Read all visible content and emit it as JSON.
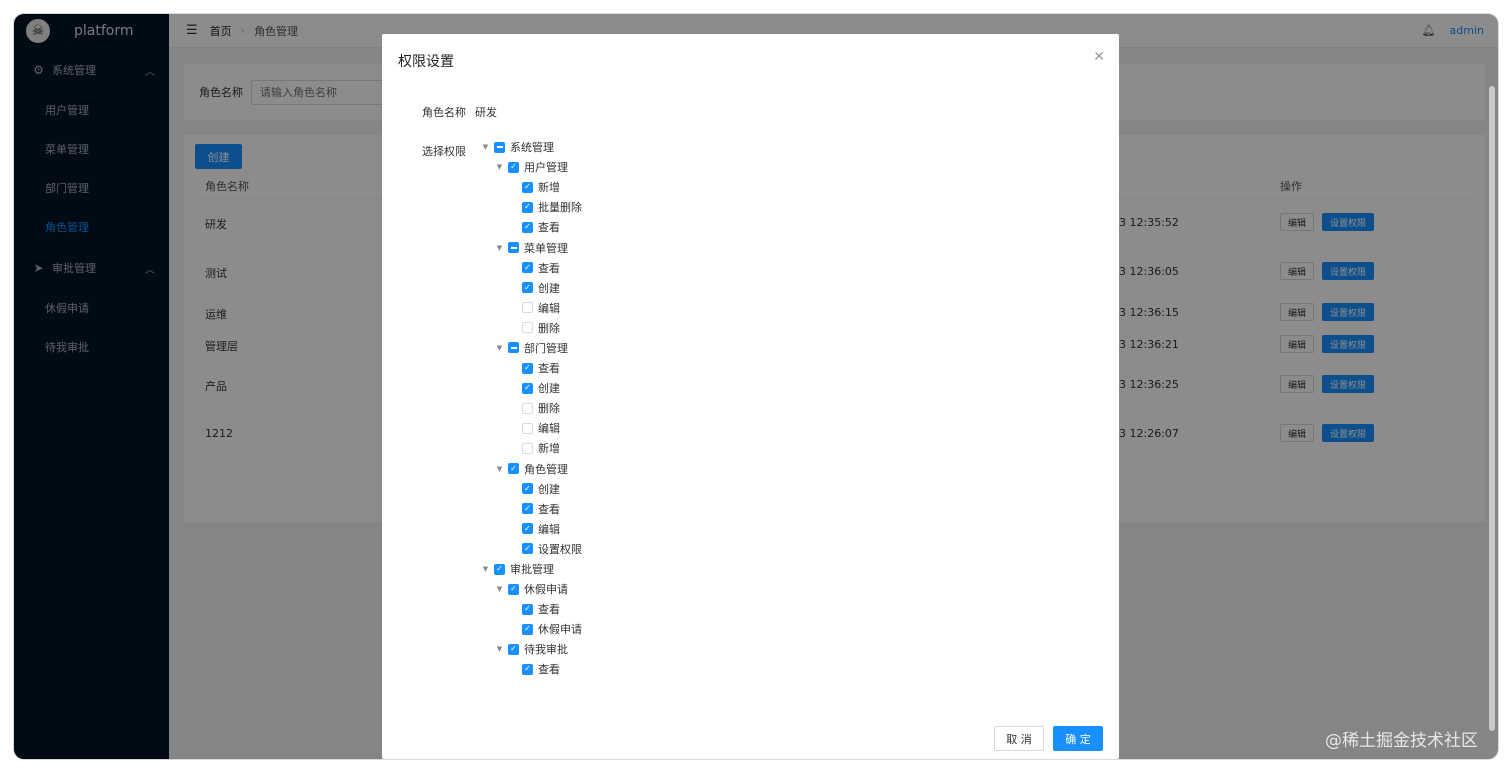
{
  "app": {
    "brand": "platform",
    "brand_icon": "skull-crossbones-logo"
  },
  "sidebar": {
    "groups": [
      {
        "label": "系统管理",
        "icon": "gear-icon",
        "items": [
          "用户管理",
          "菜单管理",
          "部门管理",
          "角色管理"
        ],
        "active_item": "角色管理"
      },
      {
        "label": "审批管理",
        "icon": "paper-plane-icon",
        "items": [
          "休假申请",
          "待我审批"
        ]
      }
    ]
  },
  "header": {
    "breadcrumb_home": "首页",
    "breadcrumb_current": "角色管理",
    "user": "admin"
  },
  "search": {
    "label": "角色名称",
    "placeholder": "请输入角色名称"
  },
  "table": {
    "create_label": "创建",
    "headers": {
      "name": "角色名称",
      "ops": "操作"
    },
    "rows": [
      {
        "name": "研发",
        "time": "3 12:35:52"
      },
      {
        "name": "测试",
        "time": "3 12:36:05"
      },
      {
        "name": "运维",
        "time": "3 12:36:15"
      },
      {
        "name": "管理层",
        "time": "3 12:36:21"
      },
      {
        "name": "产品",
        "time": "3 12:36:25"
      },
      {
        "name": "1212",
        "time": "3 12:26:07"
      }
    ],
    "edit_label": "编辑",
    "perm_label": "设置权限"
  },
  "modal": {
    "title": "权限设置",
    "role_label": "角色名称",
    "role_value": "研发",
    "perm_label": "选择权限",
    "cancel_label": "取 消",
    "ok_label": "确 定",
    "tree": [
      {
        "label": "系统管理",
        "state": "half",
        "children": [
          {
            "label": "用户管理",
            "state": "checked",
            "children": [
              {
                "label": "新增",
                "state": "checked"
              },
              {
                "label": "批量删除",
                "state": "checked"
              },
              {
                "label": "查看",
                "state": "checked"
              }
            ]
          },
          {
            "label": "菜单管理",
            "state": "half",
            "children": [
              {
                "label": "查看",
                "state": "checked"
              },
              {
                "label": "创建",
                "state": "checked"
              },
              {
                "label": "编辑",
                "state": "unchecked"
              },
              {
                "label": "删除",
                "state": "unchecked"
              }
            ]
          },
          {
            "label": "部门管理",
            "state": "half",
            "children": [
              {
                "label": "查看",
                "state": "checked"
              },
              {
                "label": "创建",
                "state": "checked"
              },
              {
                "label": "删除",
                "state": "unchecked"
              },
              {
                "label": "编辑",
                "state": "unchecked"
              },
              {
                "label": "新增",
                "state": "unchecked"
              }
            ]
          },
          {
            "label": "角色管理",
            "state": "checked",
            "children": [
              {
                "label": "创建",
                "state": "checked"
              },
              {
                "label": "查看",
                "state": "checked"
              },
              {
                "label": "编辑",
                "state": "checked"
              },
              {
                "label": "设置权限",
                "state": "checked"
              }
            ]
          }
        ]
      },
      {
        "label": "审批管理",
        "state": "checked",
        "children": [
          {
            "label": "休假申请",
            "state": "checked",
            "children": [
              {
                "label": "查看",
                "state": "checked"
              },
              {
                "label": "休假申请",
                "state": "checked"
              }
            ]
          },
          {
            "label": "待我审批",
            "state": "checked",
            "children": [
              {
                "label": "查看",
                "state": "checked"
              }
            ]
          }
        ]
      }
    ]
  },
  "watermark": "@稀土掘金技术社区",
  "colors": {
    "primary": "#1890ff",
    "sidebar_bg": "#001529"
  }
}
